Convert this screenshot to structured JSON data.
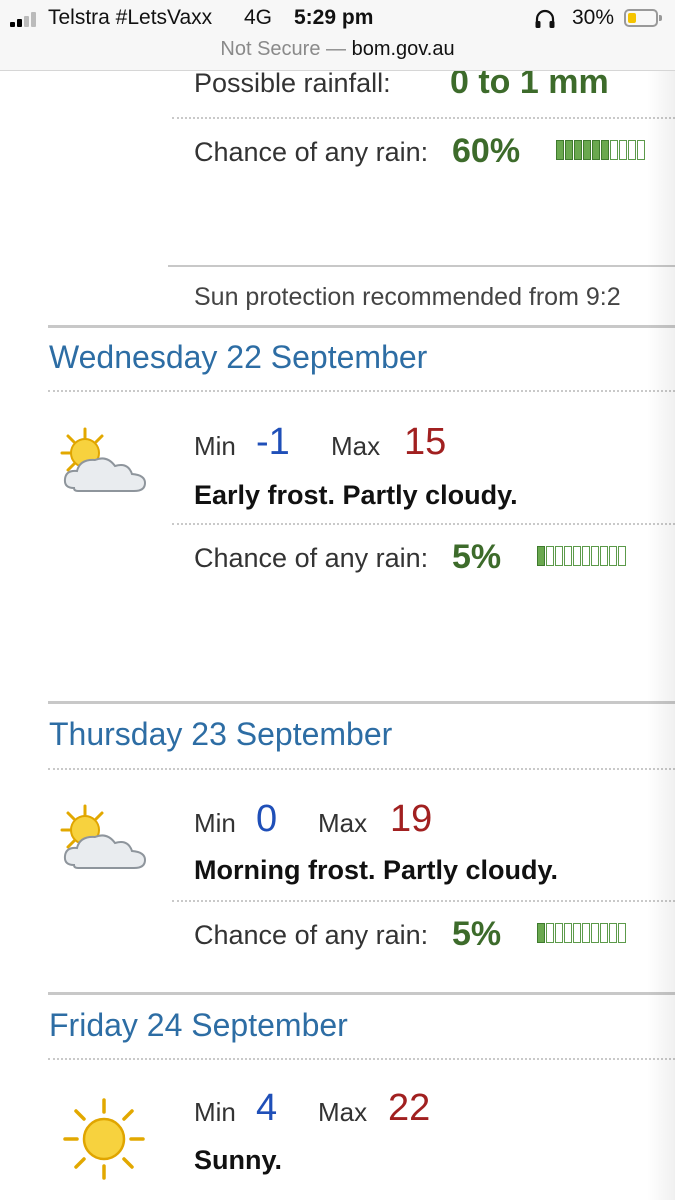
{
  "status_bar": {
    "carrier": "Telstra #LetsVaxx",
    "network": "4G",
    "time": "5:29 pm",
    "battery_percent": "30%",
    "battery_level": 0.3
  },
  "url_bar": {
    "security": "Not Secure",
    "separator": "—",
    "domain": "bom.gov.au"
  },
  "colors": {
    "heading_blue": "#2d6da4",
    "min_temp_blue": "#1f4fb8",
    "max_temp_red": "#a12020",
    "rain_green": "#3d6b2b"
  },
  "today_partial": {
    "possible_rainfall_label": "Possible rainfall:",
    "possible_rainfall_value": "0 to 1 mm",
    "chance_label": "Chance of any rain:",
    "chance_value": "60%",
    "chance_fraction": 0.6,
    "sun_protection": "Sun protection recommended from 9:2"
  },
  "forecast": [
    {
      "day": "Wednesday 22 September",
      "icon": "partly-cloudy-icon",
      "min_label": "Min",
      "min": "-1",
      "max_label": "Max",
      "max": "15",
      "summary": "Early frost. Partly cloudy.",
      "chance_label": "Chance of any rain:",
      "chance_value": "5%",
      "chance_fraction": 0.05
    },
    {
      "day": "Thursday 23 September",
      "icon": "partly-cloudy-icon",
      "min_label": "Min",
      "min": "0",
      "max_label": "Max",
      "max": "19",
      "summary": "Morning frost. Partly cloudy.",
      "chance_label": "Chance of any rain:",
      "chance_value": "5%",
      "chance_fraction": 0.05
    },
    {
      "day": "Friday 24 September",
      "icon": "sunny-icon",
      "min_label": "Min",
      "min": "4",
      "max_label": "Max",
      "max": "22",
      "summary": "Sunny."
    }
  ]
}
